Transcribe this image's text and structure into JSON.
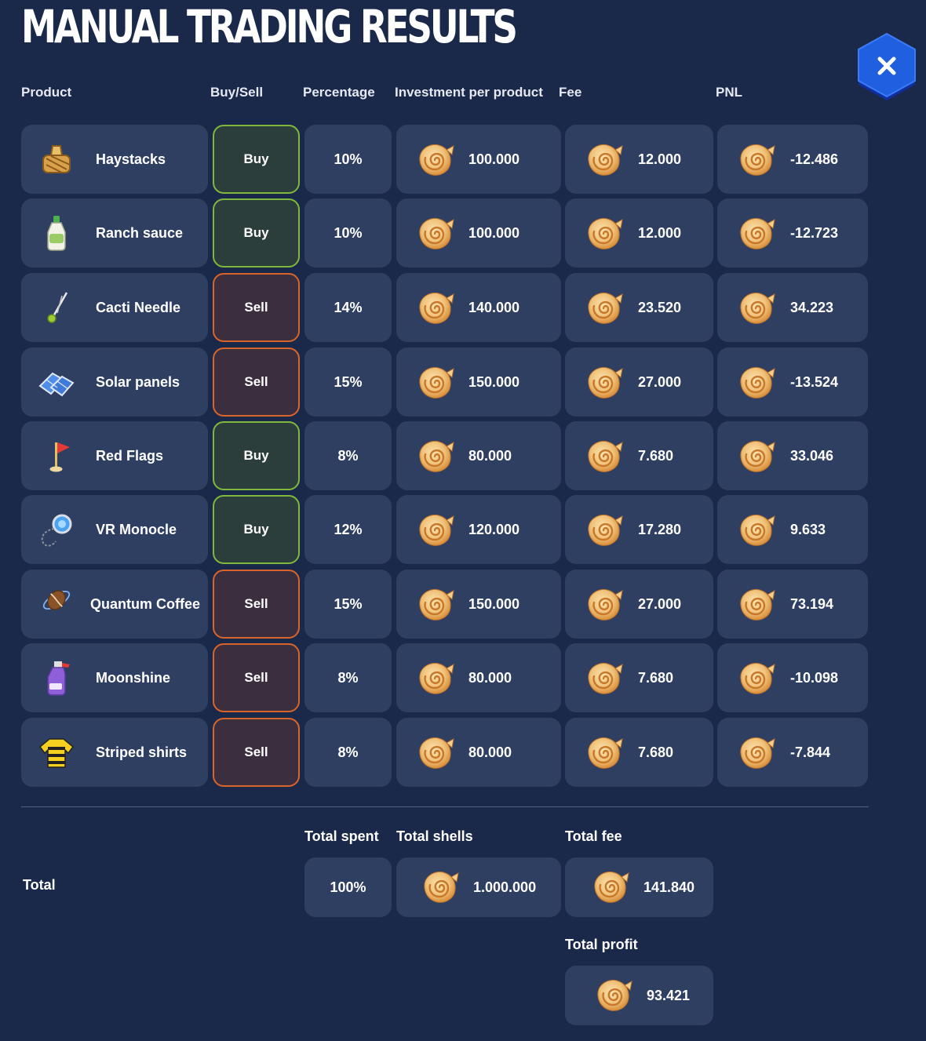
{
  "title": "MANUAL TRADING RESULTS",
  "close_icon": "close-icon",
  "headers": {
    "product": "Product",
    "side": "Buy/Sell",
    "percentage": "Percentage",
    "investment": "Investment per product",
    "fee": "Fee",
    "pnl": "PNL"
  },
  "rows": [
    {
      "product": "Haystacks",
      "icon": "haystack-icon",
      "side": "Buy",
      "percentage": "10%",
      "investment": "100.000",
      "fee": "12.000",
      "pnl": "-12.486"
    },
    {
      "product": "Ranch sauce",
      "icon": "ranch-sauce-bottle-icon",
      "side": "Buy",
      "percentage": "10%",
      "investment": "100.000",
      "fee": "12.000",
      "pnl": "-12.723"
    },
    {
      "product": "Cacti Needle",
      "icon": "cacti-needle-icon",
      "side": "Sell",
      "percentage": "14%",
      "investment": "140.000",
      "fee": "23.520",
      "pnl": "34.223"
    },
    {
      "product": "Solar panels",
      "icon": "solar-panels-icon",
      "side": "Sell",
      "percentage": "15%",
      "investment": "150.000",
      "fee": "27.000",
      "pnl": "-13.524"
    },
    {
      "product": "Red Flags",
      "icon": "red-flag-icon",
      "side": "Buy",
      "percentage": "8%",
      "investment": "80.000",
      "fee": "7.680",
      "pnl": "33.046"
    },
    {
      "product": "VR Monocle",
      "icon": "vr-monocle-icon",
      "side": "Buy",
      "percentage": "12%",
      "investment": "120.000",
      "fee": "17.280",
      "pnl": "9.633"
    },
    {
      "product": "Quantum Coffee",
      "icon": "quantum-coffee-icon",
      "side": "Sell",
      "percentage": "15%",
      "investment": "150.000",
      "fee": "27.000",
      "pnl": "73.194"
    },
    {
      "product": "Moonshine",
      "icon": "moonshine-spray-bottle-icon",
      "side": "Sell",
      "percentage": "8%",
      "investment": "80.000",
      "fee": "7.680",
      "pnl": "-10.098"
    },
    {
      "product": "Striped shirts",
      "icon": "striped-shirt-icon",
      "side": "Sell",
      "percentage": "8%",
      "investment": "80.000",
      "fee": "7.680",
      "pnl": "-7.844"
    }
  ],
  "currency_icon": "shell-currency-icon",
  "totals": {
    "label": "Total",
    "spent_label": "Total spent",
    "spent": "100%",
    "shells_label": "Total shells",
    "shells": "1.000.000",
    "fee_label": "Total fee",
    "fee": "141.840",
    "profit_label": "Total profit",
    "profit": "93.421"
  },
  "colors": {
    "background": "#1a2849",
    "cell": "#2f3f62",
    "buy_border": "#7fb83a",
    "sell_border": "#d8652a",
    "close_button": "#1f5fe0"
  }
}
